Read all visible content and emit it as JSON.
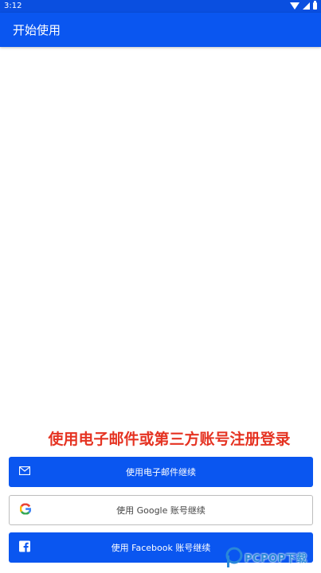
{
  "status_bar": {
    "time": "3:12",
    "icons": [
      "wifi-icon",
      "signal-icon",
      "battery-icon"
    ]
  },
  "app_bar": {
    "title": "开始使用"
  },
  "promo": {
    "caption": "使用电子邮件或第三方账号注册登录"
  },
  "buttons": {
    "email": "使用电子邮件继续",
    "google": "使用 Google 账号继续",
    "facebook": "使用 Facebook 账号继续"
  },
  "watermark": {
    "text": "PCPOP下载"
  },
  "colors": {
    "primary": "#0a56f0",
    "status_bar": "#0a4fe0",
    "caption": "#e53322",
    "watermark": "#2a88d8"
  }
}
